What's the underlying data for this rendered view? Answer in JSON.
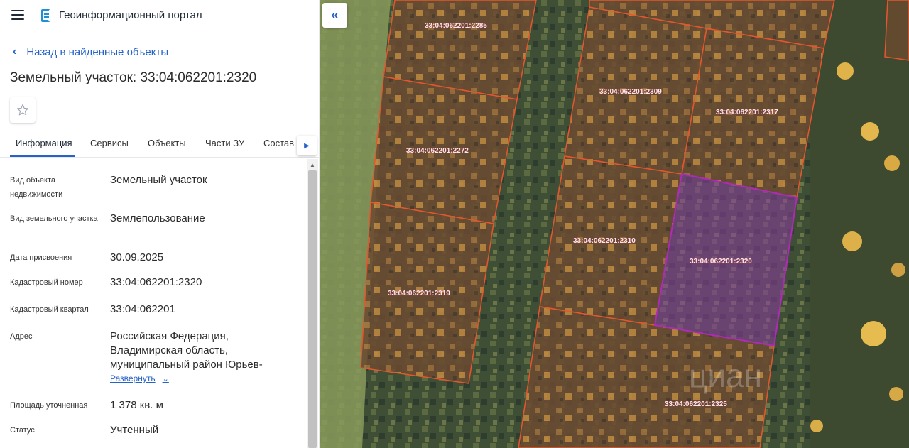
{
  "header": {
    "portal_title": "Геоинформационный портал",
    "menu_icon": "hamburger-menu-icon",
    "logo_icon": "portal-logo-icon"
  },
  "navigation": {
    "back_label": "Назад в найденные объекты"
  },
  "object": {
    "title": "Земельный участок: 33:04:062201:2320"
  },
  "tabs": [
    {
      "label": "Информация",
      "active": true
    },
    {
      "label": "Сервисы",
      "active": false
    },
    {
      "label": "Объекты",
      "active": false
    },
    {
      "label": "Части ЗУ",
      "active": false
    },
    {
      "label": "Состав",
      "active": false
    }
  ],
  "info": {
    "rows": [
      {
        "label": "Вид объекта недвижимости",
        "value": "Земельный участок"
      },
      {
        "label": "Вид земельного участка",
        "value": "Землепользование"
      },
      {
        "label": "Дата присвоения",
        "value": "30.09.2025"
      },
      {
        "label": "Кадастровый номер",
        "value": "33:04:062201:2320"
      },
      {
        "label": "Кадастровый квартал",
        "value": "33:04:062201"
      },
      {
        "label": "Адрес",
        "value": "Российская Федерация, Владимирская область, муниципальный район Юрьев-"
      },
      {
        "label": "Площадь уточненная",
        "value": "1 378 кв. м"
      },
      {
        "label": "Статус",
        "value": "Учтенный"
      }
    ],
    "expand_label": "Развернуть"
  },
  "map": {
    "parcels": [
      {
        "id": "33:04:062201:2285"
      },
      {
        "id": "33:04:062201:2272"
      },
      {
        "id": "33:04:062201:2319"
      },
      {
        "id": "33:04:062201:2309"
      },
      {
        "id": "33:04:062201:2317"
      },
      {
        "id": "33:04:062201:2310"
      },
      {
        "id": "33:04:062201:2320",
        "selected": true
      },
      {
        "id": "33:04:062201:2325"
      }
    ],
    "watermark": "циан",
    "colors": {
      "parcel_border": "#e4572e",
      "selected_border": "#b02ab8",
      "selected_fill": "#8e3ca0"
    }
  },
  "colors": {
    "accent": "#2563c7"
  }
}
